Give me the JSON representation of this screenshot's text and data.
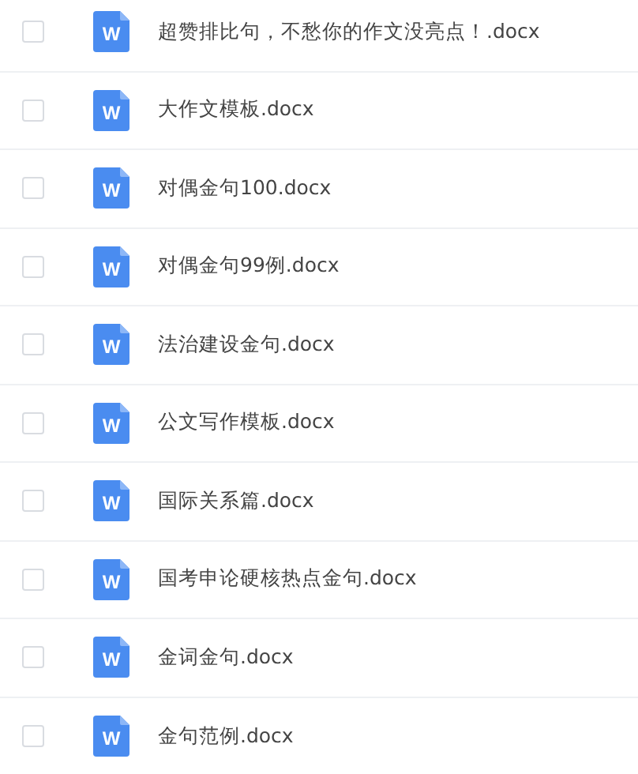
{
  "files": [
    {
      "name": "超赞排比句，不愁你的作文没亮点！.docx",
      "icon_letter": "W",
      "checked": false
    },
    {
      "name": "大作文模板.docx",
      "icon_letter": "W",
      "checked": false
    },
    {
      "name": "对偶金句100.docx",
      "icon_letter": "W",
      "checked": false
    },
    {
      "name": "对偶金句99例.docx",
      "icon_letter": "W",
      "checked": false
    },
    {
      "name": "法治建设金句.docx",
      "icon_letter": "W",
      "checked": false
    },
    {
      "name": "公文写作模板.docx",
      "icon_letter": "W",
      "checked": false
    },
    {
      "name": "国际关系篇.docx",
      "icon_letter": "W",
      "checked": false
    },
    {
      "name": "国考申论硬核热点金句.docx",
      "icon_letter": "W",
      "checked": false
    },
    {
      "name": "金词金句.docx",
      "icon_letter": "W",
      "checked": false
    },
    {
      "name": "金句范例.docx",
      "icon_letter": "W",
      "checked": false
    }
  ]
}
